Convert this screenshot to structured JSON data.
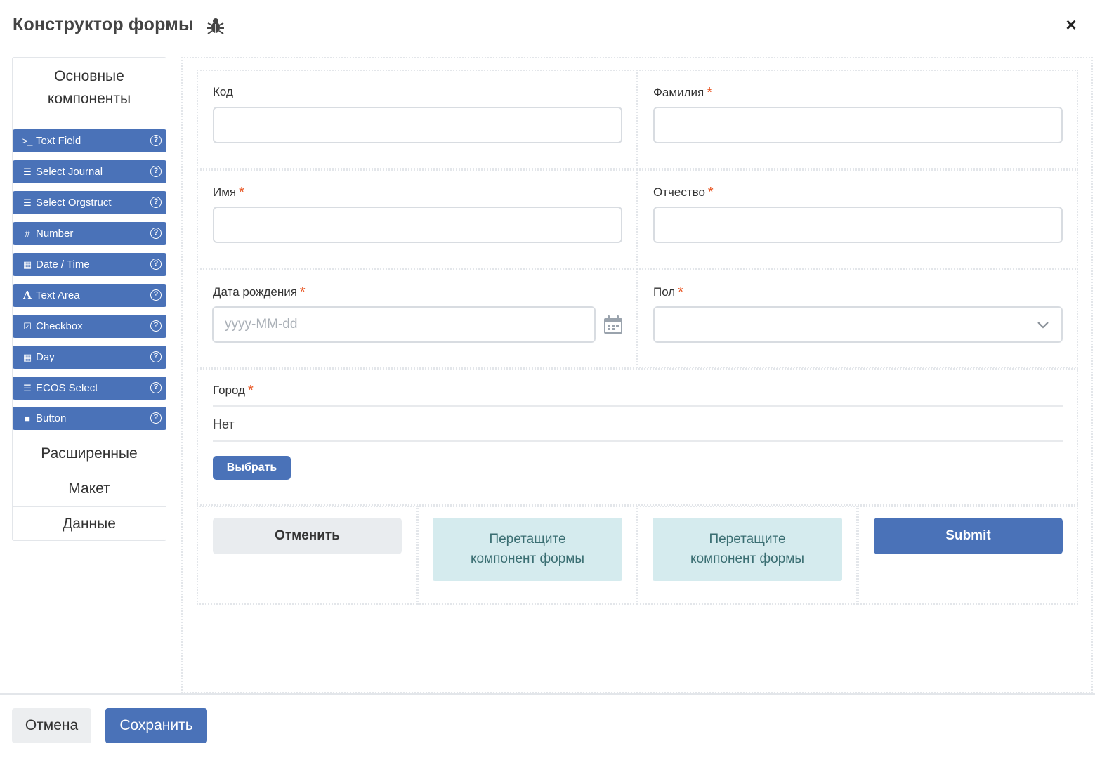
{
  "header": {
    "title": "Конструктор формы",
    "close": "×"
  },
  "sidebar": {
    "heading": "Основные компоненты",
    "components": [
      {
        "label": "Text Field",
        "icon": "terminal-icon",
        "glyph": ">_"
      },
      {
        "label": "Select Journal",
        "icon": "list-icon",
        "glyph": "☰"
      },
      {
        "label": "Select Orgstruct",
        "icon": "list-icon",
        "glyph": "☰"
      },
      {
        "label": "Number",
        "icon": "hash-icon",
        "glyph": "#"
      },
      {
        "label": "Date / Time",
        "icon": "calendar-plus-icon",
        "glyph": "▦"
      },
      {
        "label": "Text Area",
        "icon": "font-icon",
        "glyph": "A"
      },
      {
        "label": "Checkbox",
        "icon": "check-square-icon",
        "glyph": "☑"
      },
      {
        "label": "Day",
        "icon": "calendar-icon",
        "glyph": "▦"
      },
      {
        "label": "ECOS Select",
        "icon": "list-icon",
        "glyph": "☰"
      },
      {
        "label": "Button",
        "icon": "stop-icon",
        "glyph": "■"
      }
    ],
    "help_glyph": "?",
    "groups": [
      "Расширенные",
      "Макет",
      "Данные"
    ]
  },
  "form": {
    "kod_label": "Код",
    "familiya_label": "Фамилия",
    "imya_label": "Имя",
    "otchestvo_label": "Отчество",
    "dob_label": "Дата рождения",
    "dob_placeholder": "yyyy-MM-dd",
    "pol_label": "Пол",
    "city_label": "Город",
    "city_value": "Нет",
    "city_select_button": "Выбрать",
    "required_mark": "*",
    "cancel_button": "Отменить",
    "dropzone_text_1": "Перетащите",
    "dropzone_text_2": "компонент формы",
    "submit_button": "Submit"
  },
  "footer": {
    "cancel": "Отмена",
    "save": "Сохранить"
  },
  "colors": {
    "primary": "#4a72b8",
    "required": "#e8531f",
    "dropzone": "#d5ebee"
  }
}
